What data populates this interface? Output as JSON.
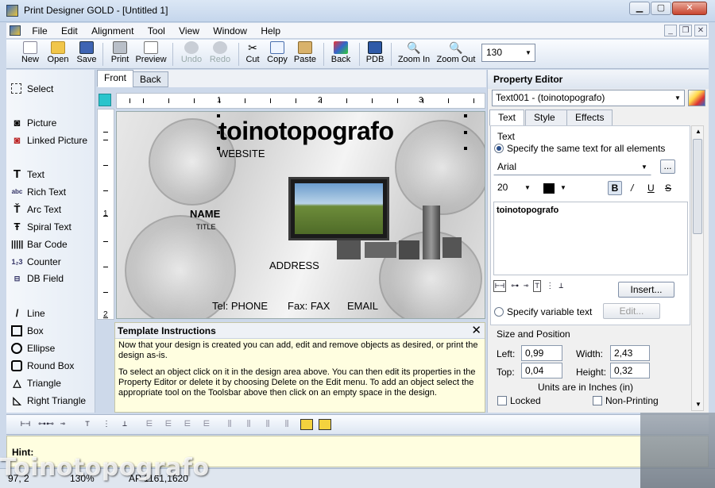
{
  "window": {
    "title": "Print Designer GOLD  - [Untitled 1]",
    "min": "▁",
    "max": "▢",
    "close": "✕"
  },
  "menu": [
    "File",
    "Edit",
    "Alignment",
    "Tool",
    "View",
    "Window",
    "Help"
  ],
  "toolbar": {
    "new": "New",
    "open": "Open",
    "save": "Save",
    "print": "Print",
    "preview": "Preview",
    "undo": "Undo",
    "redo": "Redo",
    "cut": "Cut",
    "copy": "Copy",
    "paste": "Paste",
    "back": "Back",
    "pdb": "PDB",
    "zoom_in": "Zoom In",
    "zoom_out": "Zoom Out",
    "zoom_value": "130"
  },
  "tools": {
    "select": "Select",
    "picture": "Picture",
    "linked_picture": "Linked Picture",
    "text": "Text",
    "rich_text": "Rich Text",
    "arc_text": "Arc Text",
    "spiral_text": "Spiral Text",
    "bar_code": "Bar Code",
    "counter": "Counter",
    "db_field": "DB Field",
    "line": "Line",
    "box": "Box",
    "ellipse": "Ellipse",
    "round_box": "Round Box",
    "triangle": "Triangle",
    "right_triangle": "Right Triangle"
  },
  "tabs": {
    "front": "Front",
    "back": "Back"
  },
  "ruler": {
    "h_labels": [
      "1",
      "2",
      "3"
    ],
    "v_labels": [
      "1",
      "2"
    ]
  },
  "card": {
    "company": "toinotopografo",
    "website": "WEBSITE",
    "name": "NAME",
    "title": "TITLE",
    "address": "ADDRESS",
    "tel": "Tel: PHONE",
    "fax": "Fax: FAX",
    "email": "EMAIL"
  },
  "instructions": {
    "heading": "Template Instructions",
    "p1": "Now that your design is created you can add, edit and remove objects as desired, or print the design as-is.",
    "p2": "To select an object click on it in the design area above. You can then edit its properties in the Property Editor or delete it by choosing Delete on the Edit menu. To add an object select the appropriate tool on the Toolsbar above then click on an empty space in the design."
  },
  "property_editor": {
    "title": "Property Editor",
    "object": "Text001 - (toinotopografo)",
    "tabs": [
      "Text",
      "Style",
      "Effects"
    ],
    "text_section": "Text",
    "same_text": "Specify the same text for all elements",
    "font": "Arial",
    "size": "20",
    "bold": "B",
    "italic": "/",
    "underline": "U",
    "strike": "S",
    "text_value": "toinotopografo",
    "insert": "Insert...",
    "variable_text": "Specify variable text",
    "edit": "Edit...",
    "size_position": "Size and Position",
    "left_label": "Left:",
    "left": "0,99",
    "width_label": "Width:",
    "width": "2,43",
    "top_label": "Top:",
    "top": "0,04",
    "height_label": "Height:",
    "height": "0,32",
    "units": "Units are in Inches (in)",
    "locked": "Locked",
    "non_printing": "Non-Printing",
    "more": "..."
  },
  "hint": {
    "label": "Hint:"
  },
  "status": {
    "pos": "97, 2",
    "zoom": "130%",
    "coords": "AP 1161,1620"
  },
  "watermark": "Toinotopografo"
}
